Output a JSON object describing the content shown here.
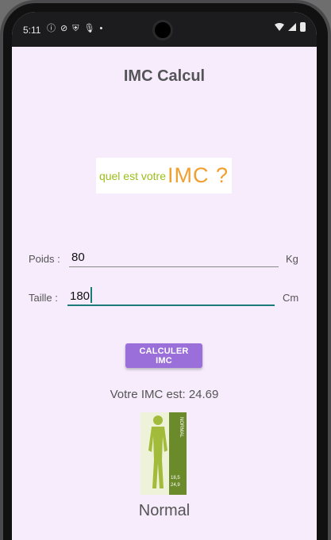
{
  "statusbar": {
    "time": "5:11",
    "left_icons": [
      "info-icon",
      "blocked-icon",
      "shield-icon",
      "mic-icon",
      "dot-icon"
    ],
    "right_icons": [
      "wifi-icon",
      "signal-icon",
      "battery-icon"
    ]
  },
  "app": {
    "title": "IMC Calcul",
    "banner": {
      "text_part1": "quel est votre",
      "text_part2": "IMC ?"
    }
  },
  "form": {
    "weight": {
      "label": "Poids :",
      "value": "80",
      "unit": "Kg"
    },
    "height": {
      "label": "Taille :",
      "value": "180",
      "unit": "Cm"
    }
  },
  "button": {
    "label": "CALCULER IMC"
  },
  "result": {
    "text": "Votre IMC est: 24.69",
    "figure_label": "NORMAL",
    "range_low": "18,5",
    "range_high": "24,9",
    "category": "Normal"
  },
  "colors": {
    "accent": "#9a6fd9",
    "background": "#f6ecfc",
    "focus_underline": "#1a7b7a"
  }
}
